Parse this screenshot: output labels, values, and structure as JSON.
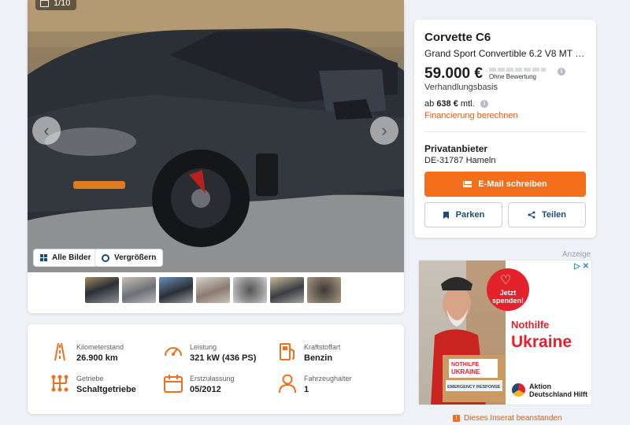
{
  "gallery": {
    "counter": "1/10",
    "buttons": {
      "all_images": "Alle Bilder",
      "zoom": "Vergrößern"
    }
  },
  "listing": {
    "title": "Corvette C6",
    "subtitle": "Grand Sport Convertible 6.2 V8 MT 1S…",
    "price": "59.000 €",
    "rating": "Ohne Bewertung",
    "negotiable": "Verhandlungsbasis",
    "monthly_prefix": "ab",
    "monthly_amount": "638 €",
    "monthly_suffix": "mtl.",
    "finance_link": "Financierung berechnen"
  },
  "seller": {
    "type": "Privatanbieter",
    "location": "DE-31787 Hameln"
  },
  "actions": {
    "email": "E-Mail schreiben",
    "park": "Parken",
    "share": "Teilen"
  },
  "attributes": [
    {
      "label": "Kilometerstand",
      "value": "26.900 km",
      "icon": "road-icon"
    },
    {
      "label": "Leistung",
      "value": "321 kW (436 PS)",
      "icon": "speedometer-icon"
    },
    {
      "label": "Kraftstoffart",
      "value": "Benzin",
      "icon": "fuel-pump-icon"
    },
    {
      "label": "Getriebe",
      "value": "Schaltgetriebe",
      "icon": "gearshift-icon"
    },
    {
      "label": "Erstzulassung",
      "value": "05/2012",
      "icon": "calendar-icon"
    },
    {
      "label": "Fahrzeughalter",
      "value": "1",
      "icon": "person-icon"
    }
  ],
  "ad": {
    "label": "Anzeige",
    "badge": "Jetzt spenden!",
    "headline1": "Nothilfe",
    "headline2": "Ukraine",
    "sponsor1": "Aktion",
    "sponsor2": "Deutschland Hilft"
  },
  "report": "Dieses Inserat beanstanden",
  "colors": {
    "accent": "#f36f1b",
    "link_blue": "#1d4a7a",
    "ad_red": "#e3222b"
  }
}
